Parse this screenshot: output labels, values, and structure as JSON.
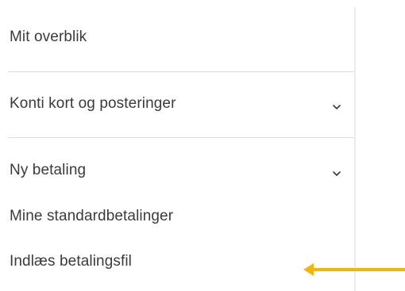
{
  "nav": {
    "items": [
      {
        "label": "Mit overblik",
        "icon": null
      },
      {
        "label": "Konti kort og posteringer",
        "icon": "chevron-down-icon"
      },
      {
        "label": "Ny betaling",
        "icon": "chevron-down-icon"
      },
      {
        "label": "Mine standardbetalinger",
        "icon": null
      },
      {
        "label": "Indlæs betalingsfil",
        "icon": null
      }
    ]
  },
  "annotation": {
    "icon": "arrow-left-icon",
    "color": "#f2b705"
  },
  "colors": {
    "text": "#3b3b3b",
    "divider": "#dcdcdc",
    "accent_arrow": "#f2b705"
  }
}
